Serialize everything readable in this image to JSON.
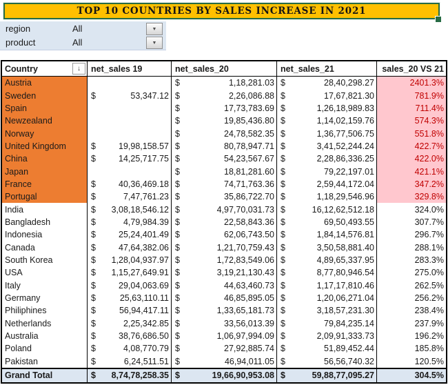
{
  "title": {
    "text": "TOP 10 COUNTRIES BY SALES INCREASE IN 2021"
  },
  "filters": {
    "region": {
      "label": "region",
      "value": "All"
    },
    "product": {
      "label": "product",
      "value": "All"
    }
  },
  "icons": {
    "sort_descending": "↓",
    "dropdown_arrow": "▼"
  },
  "colors": {
    "banner_fill": "#FFC000",
    "banner_border": "#276B44",
    "top10_country_fill": "#ED7D31",
    "top10_pct_fill": "#FFC7CE",
    "top10_pct_text": "#C00000",
    "filter_panel_fill": "#DCE6F1",
    "grand_total_fill": "#DCE6F1"
  },
  "table": {
    "currency": "$",
    "headers": {
      "country": "Country",
      "ns19": "net_sales 19",
      "ns20": "net_sales_20",
      "ns21": "net_sales_21",
      "pct": "sales_20 VS 21"
    },
    "rows": [
      {
        "country": "Austria",
        "ns19": "",
        "ns20": "1,18,281.03",
        "ns21": "28,40,298.27",
        "pct": "2401.3%",
        "top10": true
      },
      {
        "country": "Sweden",
        "ns19": "53,347.12",
        "ns20": "2,26,086.88",
        "ns21": "17,67,821.30",
        "pct": "781.9%",
        "top10": true
      },
      {
        "country": "Spain",
        "ns19": "",
        "ns20": "17,73,783.69",
        "ns21": "1,26,18,989.83",
        "pct": "711.4%",
        "top10": true
      },
      {
        "country": "Newzealand",
        "ns19": "",
        "ns20": "19,85,436.80",
        "ns21": "1,14,02,159.76",
        "pct": "574.3%",
        "top10": true
      },
      {
        "country": "Norway",
        "ns19": "",
        "ns20": "24,78,582.35",
        "ns21": "1,36,77,506.75",
        "pct": "551.8%",
        "top10": true
      },
      {
        "country": "United Kingdom",
        "ns19": "19,98,158.57",
        "ns20": "80,78,947.71",
        "ns21": "3,41,52,244.24",
        "pct": "422.7%",
        "top10": true
      },
      {
        "country": "China",
        "ns19": "14,25,717.75",
        "ns20": "54,23,567.67",
        "ns21": "2,28,86,336.25",
        "pct": "422.0%",
        "top10": true
      },
      {
        "country": "Japan",
        "ns19": "",
        "ns20": "18,81,281.60",
        "ns21": "79,22,197.01",
        "pct": "421.1%",
        "top10": true
      },
      {
        "country": "France",
        "ns19": "40,36,469.18",
        "ns20": "74,71,763.36",
        "ns21": "2,59,44,172.04",
        "pct": "347.2%",
        "top10": true
      },
      {
        "country": "Portugal",
        "ns19": "7,47,761.23",
        "ns20": "35,86,722.70",
        "ns21": "1,18,29,546.96",
        "pct": "329.8%",
        "top10": true
      },
      {
        "country": "India",
        "ns19": "3,08,18,546.12",
        "ns20": "4,97,70,031.73",
        "ns21": "16,12,62,512.18",
        "pct": "324.0%",
        "top10": false
      },
      {
        "country": "Bangladesh",
        "ns19": "4,79,984.39",
        "ns20": "22,58,843.36",
        "ns21": "69,50,493.55",
        "pct": "307.7%",
        "top10": false
      },
      {
        "country": "Indonesia",
        "ns19": "25,24,401.49",
        "ns20": "62,06,743.50",
        "ns21": "1,84,14,576.81",
        "pct": "296.7%",
        "top10": false
      },
      {
        "country": "Canada",
        "ns19": "47,64,382.06",
        "ns20": "1,21,70,759.43",
        "ns21": "3,50,58,881.40",
        "pct": "288.1%",
        "top10": false
      },
      {
        "country": "South Korea",
        "ns19": "1,28,04,937.97",
        "ns20": "1,72,83,549.06",
        "ns21": "4,89,65,337.95",
        "pct": "283.3%",
        "top10": false
      },
      {
        "country": "USA",
        "ns19": "1,15,27,649.91",
        "ns20": "3,19,21,130.43",
        "ns21": "8,77,80,946.54",
        "pct": "275.0%",
        "top10": false
      },
      {
        "country": "Italy",
        "ns19": "29,04,063.69",
        "ns20": "44,63,460.73",
        "ns21": "1,17,17,810.46",
        "pct": "262.5%",
        "top10": false
      },
      {
        "country": "Germany",
        "ns19": "25,63,110.11",
        "ns20": "46,85,895.05",
        "ns21": "1,20,06,271.04",
        "pct": "256.2%",
        "top10": false
      },
      {
        "country": "Philiphines",
        "ns19": "56,94,417.11",
        "ns20": "1,33,65,181.73",
        "ns21": "3,18,57,231.30",
        "pct": "238.4%",
        "top10": false
      },
      {
        "country": "Netherlands",
        "ns19": "2,25,342.85",
        "ns20": "33,56,013.39",
        "ns21": "79,84,235.14",
        "pct": "237.9%",
        "top10": false
      },
      {
        "country": "Australia",
        "ns19": "38,76,686.50",
        "ns20": "1,06,97,994.09",
        "ns21": "2,09,91,333.73",
        "pct": "196.2%",
        "top10": false
      },
      {
        "country": "Poland",
        "ns19": "4,08,770.79",
        "ns20": "27,92,885.74",
        "ns21": "51,89,452.44",
        "pct": "185.8%",
        "top10": false
      },
      {
        "country": "Pakistan",
        "ns19": "6,24,511.51",
        "ns20": "46,94,011.05",
        "ns21": "56,56,740.32",
        "pct": "120.5%",
        "top10": false
      }
    ],
    "grand_total": {
      "label": "Grand Total",
      "ns19": "8,74,78,258.35",
      "ns20": "19,66,90,953.08",
      "ns21": "59,88,77,095.27",
      "pct": "304.5%"
    }
  }
}
